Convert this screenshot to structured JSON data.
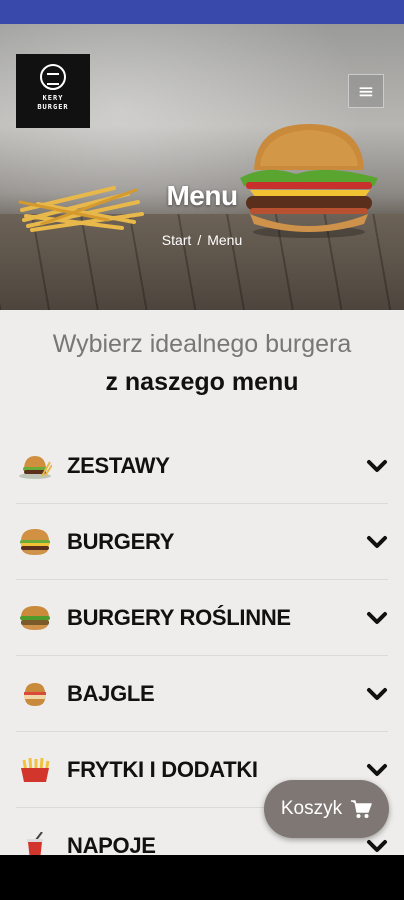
{
  "brand": {
    "logo_text": "KERY\nBURGER"
  },
  "header": {
    "page_title": "Menu"
  },
  "breadcrumb": {
    "start": "Start",
    "separator": "/",
    "current": "Menu"
  },
  "intro": {
    "subtitle": "Wybierz idealnego burgera",
    "title": "z naszego menu"
  },
  "categories": [
    {
      "label": "ZESTAWY",
      "icon": "burger-set-icon"
    },
    {
      "label": "BURGERY",
      "icon": "burger-icon"
    },
    {
      "label": "BURGERY ROŚLINNE",
      "icon": "vege-burger-icon"
    },
    {
      "label": "BAJGLE",
      "icon": "bagel-icon"
    },
    {
      "label": "FRYTKI I DODATKI",
      "icon": "fries-icon"
    },
    {
      "label": "NAPOJE",
      "icon": "drink-icon"
    }
  ],
  "cart": {
    "label": "Koszyk",
    "icon": "cart-icon"
  },
  "colors": {
    "status_bar": "#3949ab",
    "cart_button": "#7e7773"
  }
}
